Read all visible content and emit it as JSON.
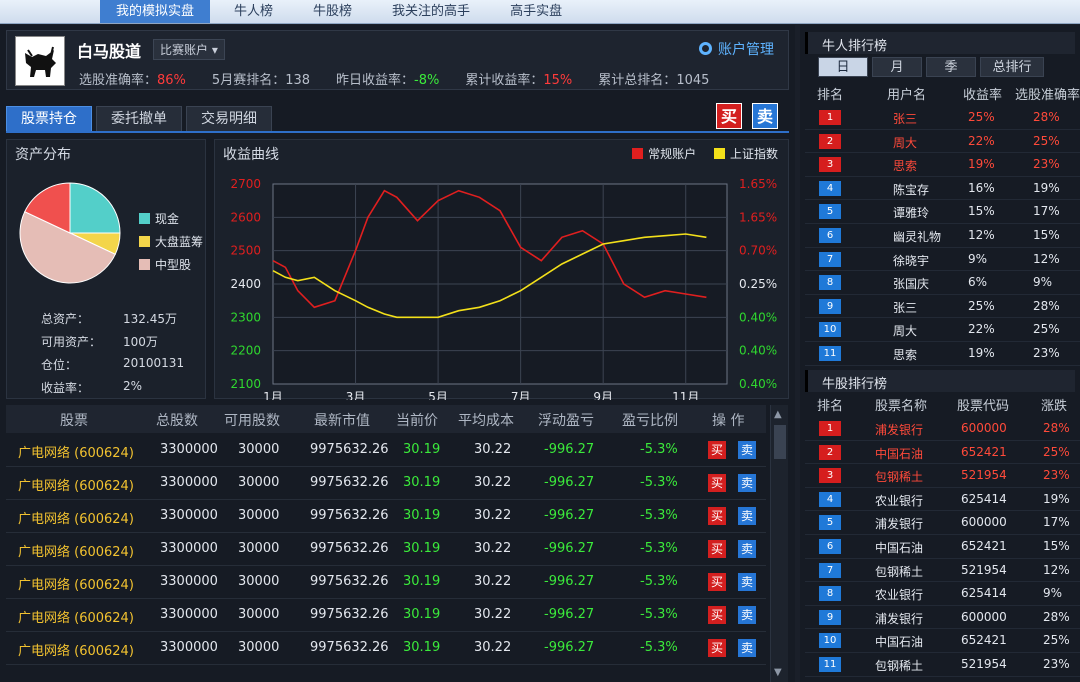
{
  "top_nav": [
    "我的模拟实盘",
    "牛人榜",
    "牛股榜",
    "我关注的高手",
    "高手实盘"
  ],
  "account": {
    "name": "白马股道",
    "type": "比赛账户",
    "manage": "账户管理",
    "stats": [
      {
        "label": "选股准确率：",
        "value": "86%"
      },
      {
        "label": "5月赛排名：",
        "value": "138"
      },
      {
        "label": "昨日收益率：",
        "value": "-8%"
      },
      {
        "label": "累计收益率：",
        "value": "15%"
      },
      {
        "label": "累计总排名：",
        "value": "1045"
      }
    ]
  },
  "tabs": [
    "股票持仓",
    "委托撤单",
    "交易明细"
  ],
  "buy_label": "买",
  "sell_label": "卖",
  "assets": {
    "title": "资产分布",
    "legend": [
      {
        "label": "现金",
        "value": 0.25,
        "color": "#53cfc9"
      },
      {
        "label": "大盘蓝筹",
        "value": 0.07,
        "color": "#f3d54a"
      },
      {
        "label": "中型股",
        "value": 0.5,
        "color": "#e5bdb6"
      },
      {
        "label": "",
        "value": 0.18,
        "color": "#f0504e"
      }
    ],
    "rows": [
      {
        "label": "总资产：",
        "value": "132.45万"
      },
      {
        "label": "可用资产：",
        "value": "100万"
      },
      {
        "label": "仓位：",
        "value": "20100131"
      },
      {
        "label": "收益率：",
        "value": "2%"
      }
    ]
  },
  "chart": {
    "title": "收益曲线",
    "legend": [
      {
        "label": "常规账户",
        "color": "#e01f1f"
      },
      {
        "label": "上证指数",
        "color": "#f3e01a"
      }
    ]
  },
  "chart_data": {
    "type": "line",
    "x_ticks": [
      "1月",
      "3月",
      "5月",
      "7月",
      "9月",
      "11月"
    ],
    "y_left_ticks": [
      "2700",
      "2600",
      "2500",
      "2400",
      "2300",
      "2200",
      "2100"
    ],
    "y_right_ticks": [
      "1.65%",
      "1.65%",
      "0.70%",
      "0.25%",
      "0.40%",
      "0.40%",
      "0.40%"
    ],
    "x": [
      1,
      1.3,
      1.6,
      2,
      2.5,
      3,
      3.3,
      3.7,
      4,
      4.5,
      5,
      5.5,
      6,
      6.5,
      7,
      7.5,
      8,
      8.5,
      9,
      9.5,
      10,
      10.5,
      11,
      11.5
    ],
    "series": [
      {
        "name": "常规账户",
        "color": "#e01f1f",
        "values": [
          2470,
          2450,
          2380,
          2330,
          2350,
          2500,
          2600,
          2680,
          2660,
          2590,
          2650,
          2680,
          2660,
          2620,
          2510,
          2470,
          2540,
          2560,
          2520,
          2400,
          2360,
          2380,
          2370,
          2360
        ]
      },
      {
        "name": "上证指数",
        "color": "#f3e01a",
        "values": [
          2440,
          2420,
          2410,
          2420,
          2380,
          2350,
          2330,
          2310,
          2300,
          2300,
          2300,
          2320,
          2330,
          2350,
          2380,
          2420,
          2460,
          2490,
          2520,
          2530,
          2540,
          2545,
          2550,
          2540
        ]
      }
    ]
  },
  "holdings": {
    "headers": [
      "股票",
      "总股数",
      "可用股数",
      "最新市值",
      "当前价",
      "平均成本",
      "浮动盈亏",
      "盈亏比例",
      "操 作"
    ],
    "rows": [
      [
        "广电网络 (600624)",
        "3300000",
        "30000",
        "9975632.26",
        "30.19",
        "30.22",
        "-996.27",
        "-5.3%"
      ],
      [
        "广电网络 (600624)",
        "3300000",
        "30000",
        "9975632.26",
        "30.19",
        "30.22",
        "-996.27",
        "-5.3%"
      ],
      [
        "广电网络 (600624)",
        "3300000",
        "30000",
        "9975632.26",
        "30.19",
        "30.22",
        "-996.27",
        "-5.3%"
      ],
      [
        "广电网络 (600624)",
        "3300000",
        "30000",
        "9975632.26",
        "30.19",
        "30.22",
        "-996.27",
        "-5.3%"
      ],
      [
        "广电网络 (600624)",
        "3300000",
        "30000",
        "9975632.26",
        "30.19",
        "30.22",
        "-996.27",
        "-5.3%"
      ],
      [
        "广电网络 (600624)",
        "3300000",
        "30000",
        "9975632.26",
        "30.19",
        "30.22",
        "-996.27",
        "-5.3%"
      ],
      [
        "广电网络 (600624)",
        "3300000",
        "30000",
        "9975632.26",
        "30.19",
        "30.22",
        "-996.27",
        "-5.3%"
      ]
    ]
  },
  "people_rank": {
    "title": "牛人排行榜",
    "tabs": [
      "日",
      "月",
      "季",
      "总排行"
    ],
    "headers": [
      "排名",
      "用户名",
      "收益率",
      "选股准确率"
    ],
    "rows": [
      [
        "1",
        "张三",
        "25%",
        "28%"
      ],
      [
        "2",
        "周大",
        "22%",
        "25%"
      ],
      [
        "3",
        "思索",
        "19%",
        "23%"
      ],
      [
        "4",
        "陈宝存",
        "16%",
        "19%"
      ],
      [
        "5",
        "谭雅玲",
        "15%",
        "17%"
      ],
      [
        "6",
        "幽灵礼物",
        "12%",
        "15%"
      ],
      [
        "7",
        "徐晓宇",
        "9%",
        "12%"
      ],
      [
        "8",
        "张国庆",
        "6%",
        "9%"
      ],
      [
        "9",
        "张三",
        "25%",
        "28%"
      ],
      [
        "10",
        "周大",
        "22%",
        "25%"
      ],
      [
        "11",
        "思索",
        "19%",
        "23%"
      ]
    ]
  },
  "stock_rank": {
    "title": "牛股排行榜",
    "headers": [
      "排名",
      "股票名称",
      "股票代码",
      "涨跌"
    ],
    "rows": [
      [
        "1",
        "浦发银行",
        "600000",
        "28%"
      ],
      [
        "2",
        "中国石油",
        "652421",
        "25%"
      ],
      [
        "3",
        "包钢稀土",
        "521954",
        "23%"
      ],
      [
        "4",
        "农业银行",
        "625414",
        "19%"
      ],
      [
        "5",
        "浦发银行",
        "600000",
        "17%"
      ],
      [
        "6",
        "中国石油",
        "652421",
        "15%"
      ],
      [
        "7",
        "包钢稀土",
        "521954",
        "12%"
      ],
      [
        "8",
        "农业银行",
        "625414",
        "9%"
      ],
      [
        "9",
        "浦发银行",
        "600000",
        "28%"
      ],
      [
        "10",
        "中国石油",
        "652421",
        "25%"
      ],
      [
        "11",
        "包钢稀土",
        "521954",
        "23%"
      ]
    ]
  }
}
